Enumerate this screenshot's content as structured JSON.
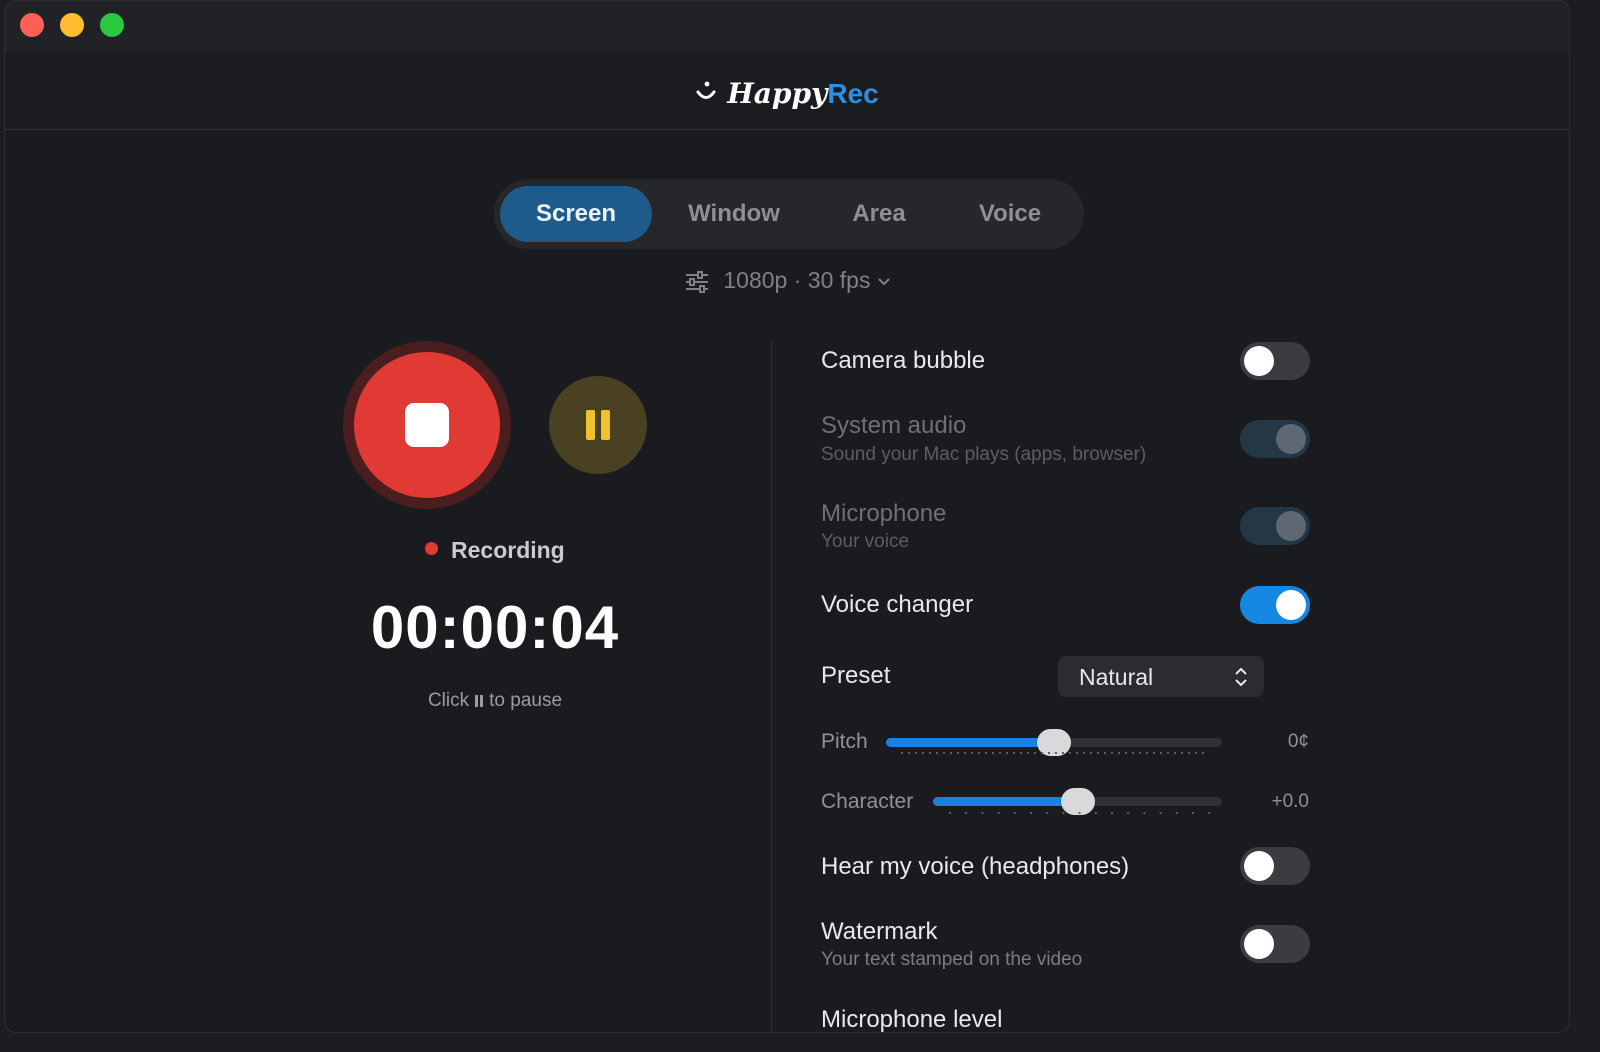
{
  "app": {
    "brand_happy": "Happy",
    "brand_rec": "Rec",
    "accent": "#2d8fe0"
  },
  "tabs": [
    {
      "label": "Screen",
      "active": true
    },
    {
      "label": "Window",
      "active": false
    },
    {
      "label": "Area",
      "active": false
    },
    {
      "label": "Voice",
      "active": false
    }
  ],
  "quality": {
    "label": "1080p · 30 fps",
    "icon": "sliders-icon",
    "dropdown_icon": "chevron-down-icon"
  },
  "recorder": {
    "status": "Recording",
    "timer": "00:00:04",
    "hint_before": "Click",
    "hint_after": "to pause",
    "stop_color": "#e13a34",
    "pause_color": "#efc22b"
  },
  "settings": {
    "camera_bubble": {
      "label": "Camera bubble",
      "on": false
    },
    "system_audio": {
      "label": "System audio",
      "sub": "Sound your Mac plays (apps, browser)",
      "on": true,
      "disabled": true
    },
    "microphone": {
      "label": "Microphone",
      "sub": "Your voice",
      "on": true,
      "disabled": true
    },
    "voice_changer": {
      "label": "Voice changer",
      "on": true
    },
    "preset": {
      "label": "Preset",
      "value": "Natural"
    },
    "pitch": {
      "label": "Pitch",
      "value_text": "0¢",
      "level": 0.5
    },
    "character": {
      "label": "Character",
      "value_text": "+0.0",
      "level": 0.5
    },
    "hear_voice": {
      "label": "Hear my voice (headphones)",
      "on": false
    },
    "watermark": {
      "label": "Watermark",
      "sub": "Your text stamped on the video",
      "on": false
    },
    "mic_level": {
      "label": "Microphone level"
    }
  }
}
